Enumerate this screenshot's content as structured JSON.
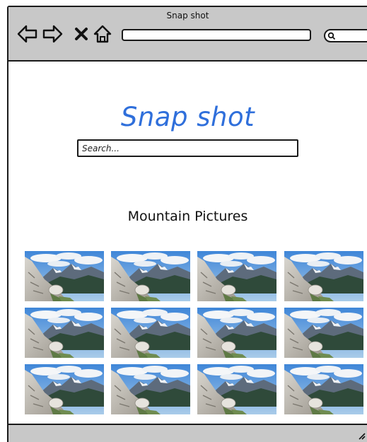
{
  "window": {
    "title": "Snap shot"
  },
  "toolbar": {
    "back_icon": "arrow-left-icon",
    "forward_icon": "arrow-right-icon",
    "stop_icon": "x-close-icon",
    "home_icon": "home-icon",
    "search_icon": "search-icon",
    "address_value": ""
  },
  "main": {
    "brand": "Snap shot",
    "search": {
      "placeholder": "Search...",
      "value": ""
    },
    "section_title": "Mountain Pictures",
    "gallery": {
      "rows": 3,
      "columns": 4,
      "image_subject": "mountain-landscape"
    }
  },
  "colors": {
    "brand": "#2f6fdb",
    "chrome": "#c8c8c8",
    "border": "#1a1a1a"
  }
}
